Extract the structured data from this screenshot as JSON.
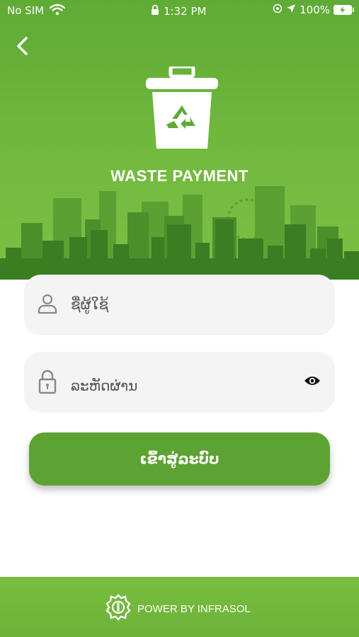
{
  "status_bar": {
    "carrier": "No SIM",
    "time": "1:32 PM",
    "battery": "100%"
  },
  "header": {
    "app_title": "WASTE PAYMENT"
  },
  "form": {
    "username_placeholder": "ຊື່ຜູ້ໃຊ້",
    "password_placeholder": "ລະຫັດຜ່ານ",
    "login_label": "ເຂົ້າສູ່ລະບົບ"
  },
  "footer": {
    "text": "POWER BY INFRASOL"
  },
  "colors": {
    "primary_green": "#5da333",
    "header_green": "#6db338",
    "field_bg": "#f4f4f4"
  },
  "icons": [
    "wifi-icon",
    "lock-icon",
    "location-icon",
    "battery-icon",
    "back-chevron-icon",
    "trash-bin-recycle-icon",
    "user-icon",
    "padlock-icon",
    "eye-icon",
    "infrasol-logo-icon"
  ]
}
